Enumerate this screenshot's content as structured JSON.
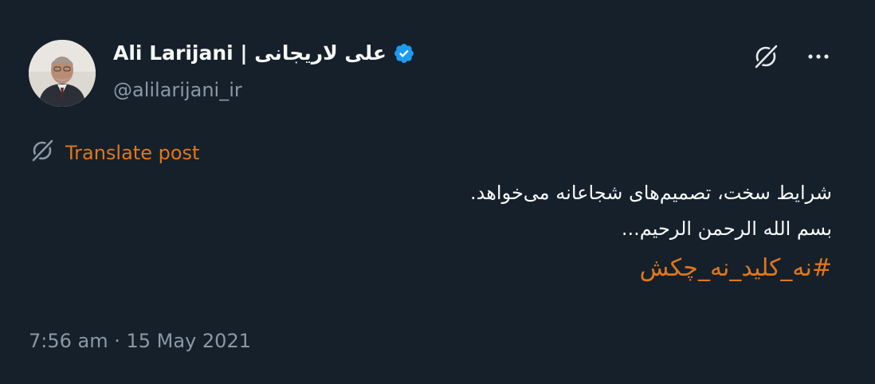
{
  "author": {
    "display_name": "Ali Larijani | علی لاریجانی",
    "handle": "@alilarijani_ir",
    "verified": true
  },
  "actions": {
    "grok_icon": "grok-icon",
    "more_icon": "more-icon"
  },
  "translate": {
    "label": "Translate post"
  },
  "content": {
    "line1": "شرایط سخت، تصمیم‌های شجاعانه می‌خواهد.",
    "line2": "بسم الله الرحمن الرحیم...",
    "hashtag": "#نه_کلید_نه_چکش"
  },
  "meta": {
    "timestamp": "7:56 am · 15 May 2021"
  },
  "colors": {
    "background": "#15202b",
    "accent": "#e1761a",
    "verified": "#1d9bf0",
    "secondary_text": "#8b98a5"
  }
}
